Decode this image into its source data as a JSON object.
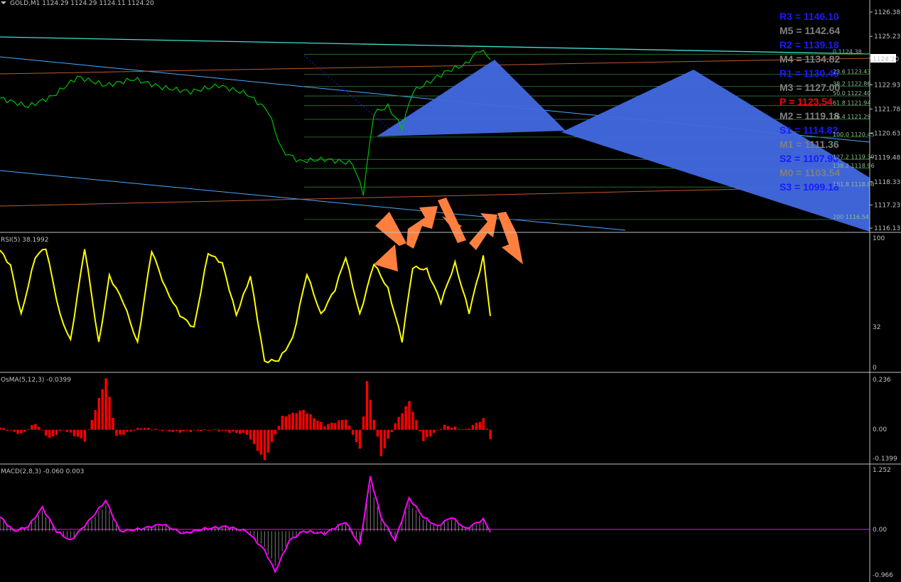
{
  "window": {
    "title": "GOLD,M1  1124.29 1124.29 1124.11 1124.20"
  },
  "colors": {
    "price": "#00c000",
    "rsi": "#ffff00",
    "osma": "#ff0000",
    "macd": "#ff00ff",
    "pivot_blue": "#1a1aff",
    "pivot_gray": "#808080",
    "pivot_red": "#ff0000",
    "triangle": "#4169e1",
    "arrow": "#ff7f3f",
    "cyan_line": "#40e0d0",
    "brown_line": "#c0582a",
    "fib_line": "#2e7d32"
  },
  "price_axis": {
    "ticks": [
      "1126.38",
      "1125.23",
      "1124.20",
      "1122.93",
      "1121.78",
      "1120.63",
      "1119.48",
      "1118.33",
      "1117.23",
      "1116.13"
    ],
    "current": "1124.20"
  },
  "pivots": [
    {
      "label": "R3 = 1146.10",
      "color": "#1a1aff"
    },
    {
      "label": "M5 = 1142.64",
      "color": "#808080"
    },
    {
      "label": "R2 = 1139.18",
      "color": "#1a1aff"
    },
    {
      "label": "M4 = 1134.82",
      "color": "#808080"
    },
    {
      "label": "R1 = 1130.46",
      "color": "#1a1aff"
    },
    {
      "label": "M3 = 1127.00",
      "color": "#808080"
    },
    {
      "label": "P  = 1123.54",
      "color": "#ff0000"
    },
    {
      "label": "M2 = 1119.18",
      "color": "#808080"
    },
    {
      "label": "S1 = 1114.82",
      "color": "#1a1aff"
    },
    {
      "label": "M1 = 1111.36",
      "color": "#808080"
    },
    {
      "label": "S2 = 1107.90",
      "color": "#1a1aff"
    },
    {
      "label": "M0 = 1103.54",
      "color": "#808080"
    },
    {
      "label": "S3 = 1099.18",
      "color": "#1a1aff"
    }
  ],
  "fib_labels": [
    {
      "price": 1124.38,
      "label": "0 1124.38"
    },
    {
      "price": 1123.43,
      "label": "23.6 1123.43"
    },
    {
      "price": 1122.86,
      "label": "38.2 1122.86"
    },
    {
      "price": 1122.4,
      "label": "50.0 1122.40"
    },
    {
      "price": 1121.94,
      "label": "61.8 1121.94"
    },
    {
      "price": 1121.29,
      "label": "76.4 1121.29"
    },
    {
      "price": 1120.45,
      "label": "100.0 1120.45"
    },
    {
      "price": 1119.39,
      "label": "127.2 1119.39"
    },
    {
      "price": 1118.96,
      "label": "138.2 1118.96"
    },
    {
      "price": 1118.08,
      "label": "161.8 1118.08"
    },
    {
      "price": 1116.54,
      "label": "200 1116.54"
    }
  ],
  "panels": {
    "rsi": {
      "title": "RSI(5) 38.1992",
      "ticks": [
        "100",
        "32",
        "0"
      ]
    },
    "osma": {
      "title": "OsMA(5,12,3) -0.0399",
      "ticks": [
        "0.236",
        "0.00",
        "-0.1399"
      ]
    },
    "macd": {
      "title": "MACD(2,8,3) -0.060 0.003",
      "ticks": [
        "1.252",
        "0.00",
        "-0.966"
      ]
    }
  },
  "chart_data": [
    {
      "type": "line",
      "name": "",
      "ylim": [
        1116.13,
        1126.38
      ],
      "n": 140,
      "anchors": [
        [
          0,
          1122.3
        ],
        [
          8,
          1121.9
        ],
        [
          15,
          1122.4
        ],
        [
          22,
          1123.3
        ],
        [
          30,
          1122.9
        ],
        [
          38,
          1123.2
        ],
        [
          46,
          1122.8
        ],
        [
          54,
          1122.6
        ],
        [
          62,
          1122.9
        ],
        [
          70,
          1122.5
        ],
        [
          76,
          1121.7
        ],
        [
          80,
          1119.8
        ],
        [
          85,
          1119.3
        ],
        [
          92,
          1119.4
        ],
        [
          100,
          1119.2
        ],
        [
          103,
          1117.8
        ],
        [
          106,
          1121.6
        ],
        [
          110,
          1121.9
        ],
        [
          114,
          1120.9
        ],
        [
          117,
          1122.6
        ],
        [
          122,
          1123.1
        ],
        [
          127,
          1123.6
        ],
        [
          132,
          1123.9
        ],
        [
          136,
          1124.6
        ],
        [
          139,
          1124.2
        ]
      ]
    },
    {
      "type": "line",
      "name": "",
      "ylim": [
        0,
        100
      ],
      "n": 140,
      "anchors": [
        [
          0,
          90
        ],
        [
          3,
          78
        ],
        [
          6,
          40
        ],
        [
          10,
          85
        ],
        [
          13,
          92
        ],
        [
          17,
          40
        ],
        [
          20,
          20
        ],
        [
          24,
          92
        ],
        [
          28,
          18
        ],
        [
          31,
          70
        ],
        [
          35,
          50
        ],
        [
          39,
          18
        ],
        [
          43,
          90
        ],
        [
          47,
          60
        ],
        [
          51,
          40
        ],
        [
          55,
          30
        ],
        [
          59,
          88
        ],
        [
          63,
          80
        ],
        [
          67,
          40
        ],
        [
          71,
          70
        ],
        [
          75,
          4
        ],
        [
          79,
          5
        ],
        [
          83,
          22
        ],
        [
          87,
          72
        ],
        [
          91,
          40
        ],
        [
          95,
          60
        ],
        [
          98,
          85
        ],
        [
          102,
          40
        ],
        [
          106,
          80
        ],
        [
          110,
          60
        ],
        [
          114,
          20
        ],
        [
          117,
          77
        ],
        [
          121,
          75
        ],
        [
          125,
          50
        ],
        [
          129,
          80
        ],
        [
          133,
          42
        ],
        [
          137,
          85
        ],
        [
          139,
          40
        ]
      ]
    },
    {
      "type": "bar",
      "name": "",
      "ylim": [
        -0.1399,
        0.236
      ],
      "n": 140,
      "anchors": [
        [
          0,
          0.01
        ],
        [
          6,
          -0.02
        ],
        [
          10,
          0.03
        ],
        [
          14,
          -0.04
        ],
        [
          18,
          0.0
        ],
        [
          24,
          -0.05
        ],
        [
          30,
          0.236
        ],
        [
          33,
          -0.03
        ],
        [
          40,
          0.01
        ],
        [
          50,
          -0.01
        ],
        [
          60,
          0.0
        ],
        [
          70,
          -0.02
        ],
        [
          75,
          -0.1399
        ],
        [
          80,
          0.06
        ],
        [
          86,
          0.09
        ],
        [
          92,
          0.02
        ],
        [
          98,
          0.05
        ],
        [
          102,
          -0.09
        ],
        [
          104,
          0.22
        ],
        [
          108,
          -0.12
        ],
        [
          112,
          0.03
        ],
        [
          116,
          0.13
        ],
        [
          120,
          -0.05
        ],
        [
          126,
          0.02
        ],
        [
          132,
          0.0
        ],
        [
          137,
          0.05
        ],
        [
          139,
          -0.04
        ]
      ]
    },
    {
      "type": "line",
      "name": "",
      "ylim": [
        -0.966,
        1.252
      ],
      "n": 140,
      "anchors": [
        [
          0,
          0.3
        ],
        [
          4,
          0.0
        ],
        [
          8,
          0.1
        ],
        [
          12,
          0.5
        ],
        [
          16,
          0.0
        ],
        [
          20,
          -0.2
        ],
        [
          25,
          0.2
        ],
        [
          30,
          0.65
        ],
        [
          34,
          0.0
        ],
        [
          40,
          0.05
        ],
        [
          46,
          0.15
        ],
        [
          52,
          -0.05
        ],
        [
          58,
          0.05
        ],
        [
          64,
          0.1
        ],
        [
          70,
          0.0
        ],
        [
          75,
          -0.4
        ],
        [
          78,
          -0.85
        ],
        [
          82,
          -0.2
        ],
        [
          86,
          0.0
        ],
        [
          92,
          -0.05
        ],
        [
          98,
          0.2
        ],
        [
          102,
          -0.3
        ],
        [
          105,
          1.15
        ],
        [
          108,
          0.3
        ],
        [
          112,
          -0.2
        ],
        [
          116,
          0.7
        ],
        [
          120,
          0.3
        ],
        [
          124,
          0.1
        ],
        [
          128,
          0.3
        ],
        [
          132,
          0.05
        ],
        [
          137,
          0.25
        ],
        [
          139,
          0.0
        ]
      ]
    }
  ]
}
